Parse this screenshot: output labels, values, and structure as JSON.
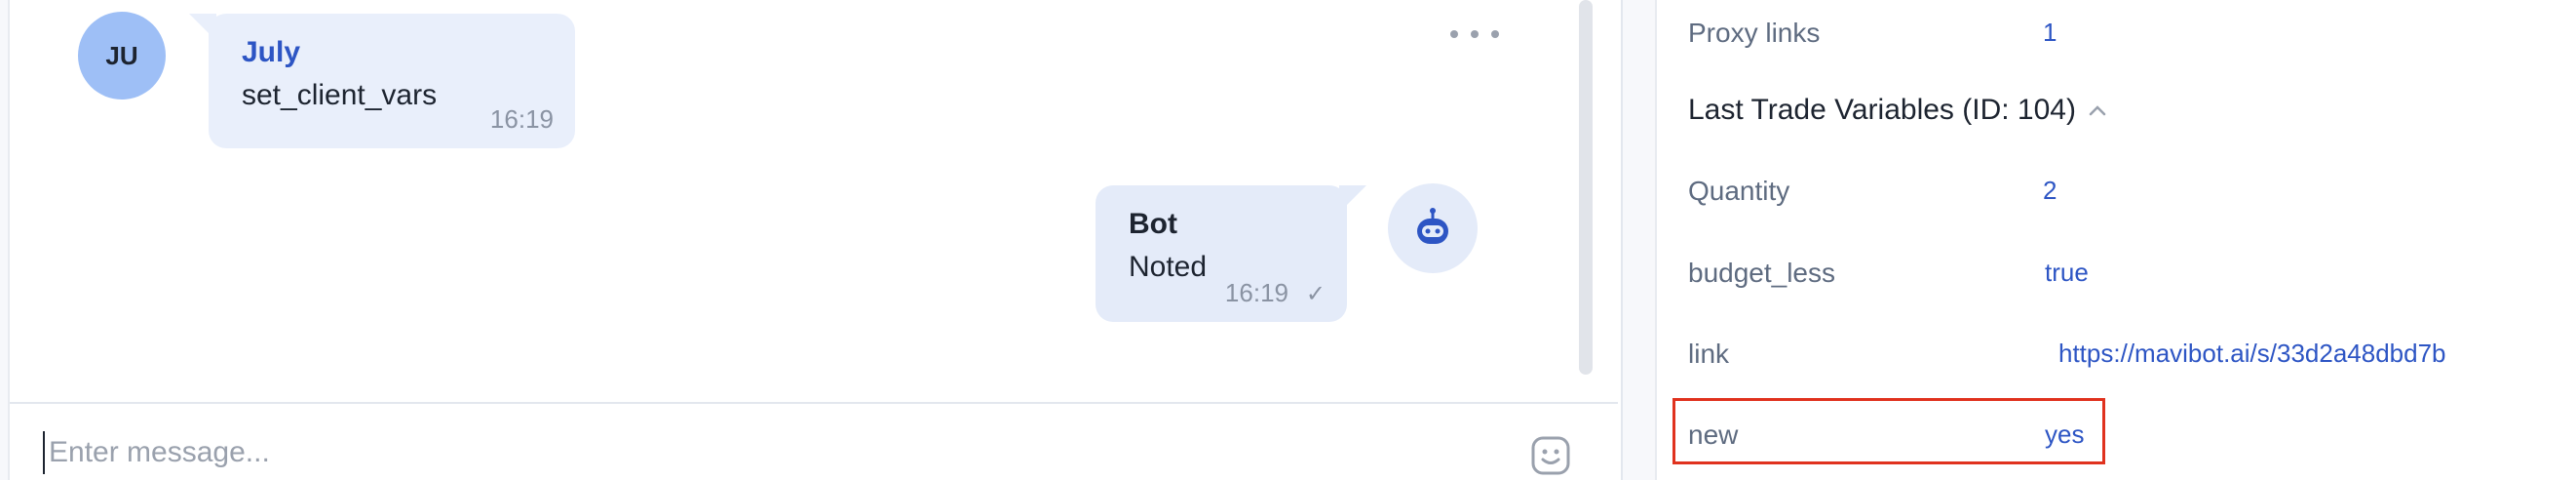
{
  "chat": {
    "messages": [
      {
        "avatar_initials": "JU",
        "sender": "July",
        "text": "set_client_vars",
        "time": "16:19"
      },
      {
        "sender": "Bot",
        "text": "Noted",
        "time": "16:19",
        "status": "sent"
      }
    ],
    "composer": {
      "placeholder": "Enter message..."
    }
  },
  "info": {
    "proxy_links": {
      "label": "Proxy links",
      "value": "1"
    },
    "section_title": "Last Trade Variables (ID: 104)",
    "variables": [
      {
        "key": "Quantity",
        "value": "2"
      },
      {
        "key": "budget_less",
        "value": "true"
      },
      {
        "key": "link",
        "value": "https://mavibot.ai/s/33d2a48dbd7b"
      },
      {
        "key": "new",
        "value": "yes"
      }
    ]
  },
  "colors": {
    "accent": "#2d55c4",
    "highlight": "#e0321e",
    "bubble": "#e9effb",
    "avatar": "#9ebff6"
  }
}
